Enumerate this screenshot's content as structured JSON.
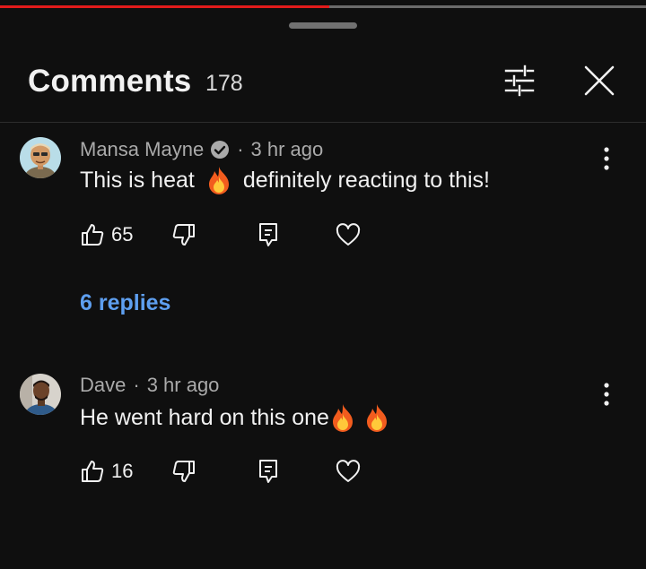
{
  "player": {
    "progress": 0.51
  },
  "header": {
    "title": "Comments",
    "count": "178"
  },
  "comments": [
    {
      "author": "Mansa Mayne",
      "verified": true,
      "time": "3 hr ago",
      "text_before": "This is heat",
      "text_after": "definitely reacting to this!",
      "likes": "65",
      "replies_label": "6 replies"
    },
    {
      "author": "Dave",
      "verified": false,
      "time": "3 hr ago",
      "text_before": "He went hard on this one",
      "text_after": "",
      "likes": "16"
    }
  ],
  "colors": {
    "accent_link": "#5e9ff0",
    "progress_red": "#e21b1b",
    "background": "#0f0f0f"
  },
  "icons": [
    "filter-icon",
    "close-icon",
    "verified-icon",
    "more-vert-icon",
    "thumb-up-icon",
    "thumb-down-icon",
    "reply-icon",
    "heart-icon",
    "fire-emoji"
  ]
}
